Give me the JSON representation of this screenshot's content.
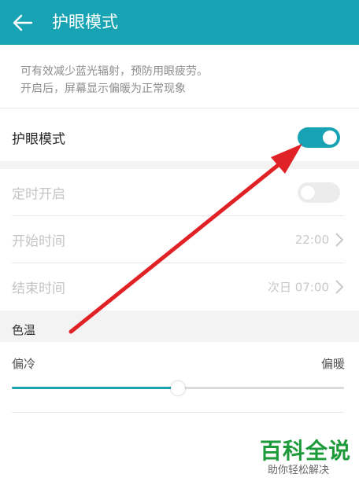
{
  "header": {
    "title": "护眼模式"
  },
  "description": {
    "line1": "可有效减少蓝光辐射，预防用眼疲劳。",
    "line2": "开启后，屏幕显示偏暖为正常现象"
  },
  "eye_mode": {
    "label": "护眼模式",
    "enabled": true
  },
  "schedule": {
    "label": "定时开启",
    "enabled": false,
    "start": {
      "label": "开始时间",
      "value": "22:00"
    },
    "end": {
      "label": "结束时间",
      "value": "次日 07:00"
    }
  },
  "color_temp": {
    "title": "色温",
    "cold_label": "偏冷",
    "warm_label": "偏暖",
    "level": 0.5
  },
  "colors": {
    "accent": "#17a3b3",
    "arrow": "#e02226"
  },
  "watermark": {
    "main": "百科全说",
    "sub": "助你轻松解决"
  }
}
